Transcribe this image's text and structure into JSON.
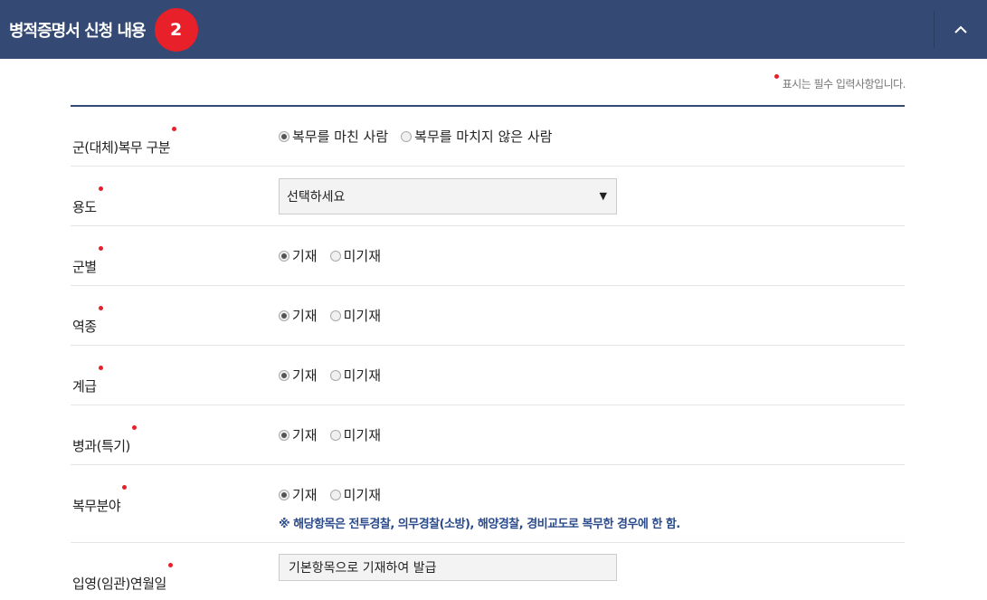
{
  "header": {
    "title": "병적증명서 신청 내용",
    "step": "2"
  },
  "required_note": "표시는 필수 입력사항입니다.",
  "rows": [
    {
      "label": "군(대체)복무 구분",
      "options": [
        "복무를 마친 사람",
        "복무를 마치지 않은 사람"
      ],
      "selected": 0
    },
    {
      "label": "용도",
      "select_value": "선택하세요"
    },
    {
      "label": "군별",
      "options": [
        "기재",
        "미기재"
      ],
      "selected": 0
    },
    {
      "label": "역종",
      "options": [
        "기재",
        "미기재"
      ],
      "selected": 0
    },
    {
      "label": "계급",
      "options": [
        "기재",
        "미기재"
      ],
      "selected": 0
    },
    {
      "label": "병과(특기)",
      "options": [
        "기재",
        "미기재"
      ],
      "selected": 0
    },
    {
      "label": "복무분야",
      "options": [
        "기재",
        "미기재"
      ],
      "selected": 0,
      "note": "※ 해당항목은 전투경찰, 의무경찰(소방), 해양경찰, 경비교도로 복무한 경우에 한 함."
    },
    {
      "label": "입영(임관)연월일",
      "readonly_value": "기본항목으로 기재하여 발급"
    }
  ],
  "colors": {
    "header": "#344a74",
    "badge": "#e8202a",
    "required": "#e8202a",
    "note": "#2a4a8c"
  },
  "icons": {
    "collapse": "chevron-up-icon",
    "select_arrow": "triangle-down-icon"
  }
}
